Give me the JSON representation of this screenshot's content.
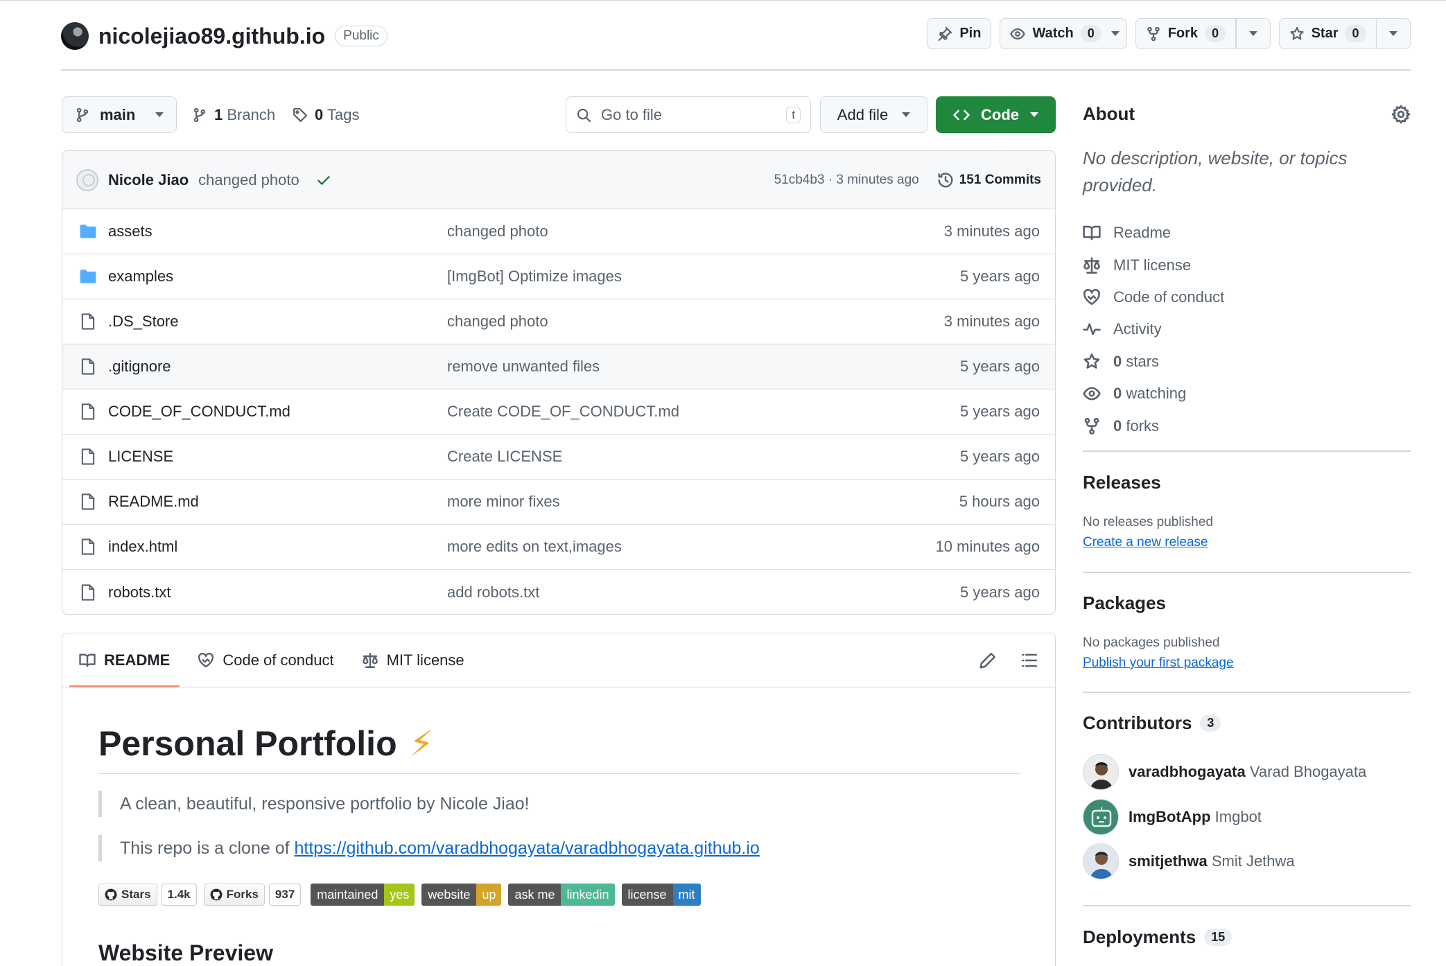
{
  "repo": {
    "owner_repo": "nicolejiao89.github.io",
    "visibility": "Public"
  },
  "header_actions": {
    "pin": "Pin",
    "watch": "Watch",
    "watch_count": "0",
    "fork": "Fork",
    "fork_count": "0",
    "star": "Star",
    "star_count": "0"
  },
  "toolbar": {
    "branch": "main",
    "branch_count": "1",
    "branch_label": "Branch",
    "tag_count": "0",
    "tag_label": "Tags",
    "goto_placeholder": "Go to file",
    "goto_key": "t",
    "add_file": "Add file",
    "code": "Code"
  },
  "latest_commit": {
    "author": "Nicole Jiao",
    "message": "changed photo",
    "hash_time": "51cb4b3 · 3 minutes ago",
    "commits": "151 Commits"
  },
  "files": [
    {
      "name": "assets",
      "type": "dir",
      "message": "changed photo",
      "date": "3 minutes ago"
    },
    {
      "name": "examples",
      "type": "dir",
      "message": "[ImgBot] Optimize images",
      "date": "5 years ago"
    },
    {
      "name": ".DS_Store",
      "type": "file",
      "message": "changed photo",
      "date": "3 minutes ago"
    },
    {
      "name": ".gitignore",
      "type": "file",
      "message": "remove unwanted files",
      "date": "5 years ago"
    },
    {
      "name": "CODE_OF_CONDUCT.md",
      "type": "file",
      "message": "Create CODE_OF_CONDUCT.md",
      "date": "5 years ago"
    },
    {
      "name": "LICENSE",
      "type": "file",
      "message": "Create LICENSE",
      "date": "5 years ago"
    },
    {
      "name": "README.md",
      "type": "file",
      "message": "more minor fixes",
      "date": "5 hours ago"
    },
    {
      "name": "index.html",
      "type": "file",
      "message": "more edits on text,images",
      "date": "10 minutes ago"
    },
    {
      "name": "robots.txt",
      "type": "file",
      "message": "add robots.txt",
      "date": "5 years ago"
    }
  ],
  "readme_tabs": {
    "readme": "README",
    "conduct": "Code of conduct",
    "license": "MIT license"
  },
  "readme": {
    "title": "Personal Portfolio",
    "title_emoji": "⚡",
    "quote1": "A clean, beautiful, responsive portfolio by Nicole Jiao!",
    "quote2_prefix": "This repo is a clone of ",
    "quote2_link": "https://github.com/varadbhogayata/varadbhogayata.github.io",
    "badges": {
      "stars_label": "Stars",
      "stars_count": "1.4k",
      "forks_label": "Forks",
      "forks_count": "937",
      "maintained_k": "maintained",
      "maintained_v": "yes",
      "website_k": "website",
      "website_v": "up",
      "askme_k": "ask me",
      "askme_v": "linkedin",
      "license_k": "license",
      "license_v": "mit"
    },
    "h2": "Website Preview"
  },
  "about": {
    "heading": "About",
    "description": "No description, website, or topics provided.",
    "readme": "Readme",
    "license": "MIT license",
    "conduct": "Code of conduct",
    "activity": "Activity",
    "stars_n": "0",
    "stars": "stars",
    "watching_n": "0",
    "watching": "watching",
    "forks_n": "0",
    "forks": "forks"
  },
  "releases": {
    "heading": "Releases",
    "text": "No releases published",
    "link": "Create a new release"
  },
  "packages": {
    "heading": "Packages",
    "text": "No packages published",
    "link": "Publish your first package"
  },
  "contributors": {
    "heading": "Contributors",
    "count": "3",
    "list": [
      {
        "login": "varadbhogayata",
        "name": "Varad Bhogayata"
      },
      {
        "login": "ImgBotApp",
        "name": "Imgbot"
      },
      {
        "login": "smitjethwa",
        "name": "Smit Jethwa"
      }
    ]
  },
  "deployments": {
    "heading": "Deployments",
    "count": "15"
  },
  "colors": {
    "accent_green": "#1f883d",
    "link_blue": "#0969da",
    "folder_blue": "#54aeff",
    "tab_underline": "#fd8c73"
  }
}
